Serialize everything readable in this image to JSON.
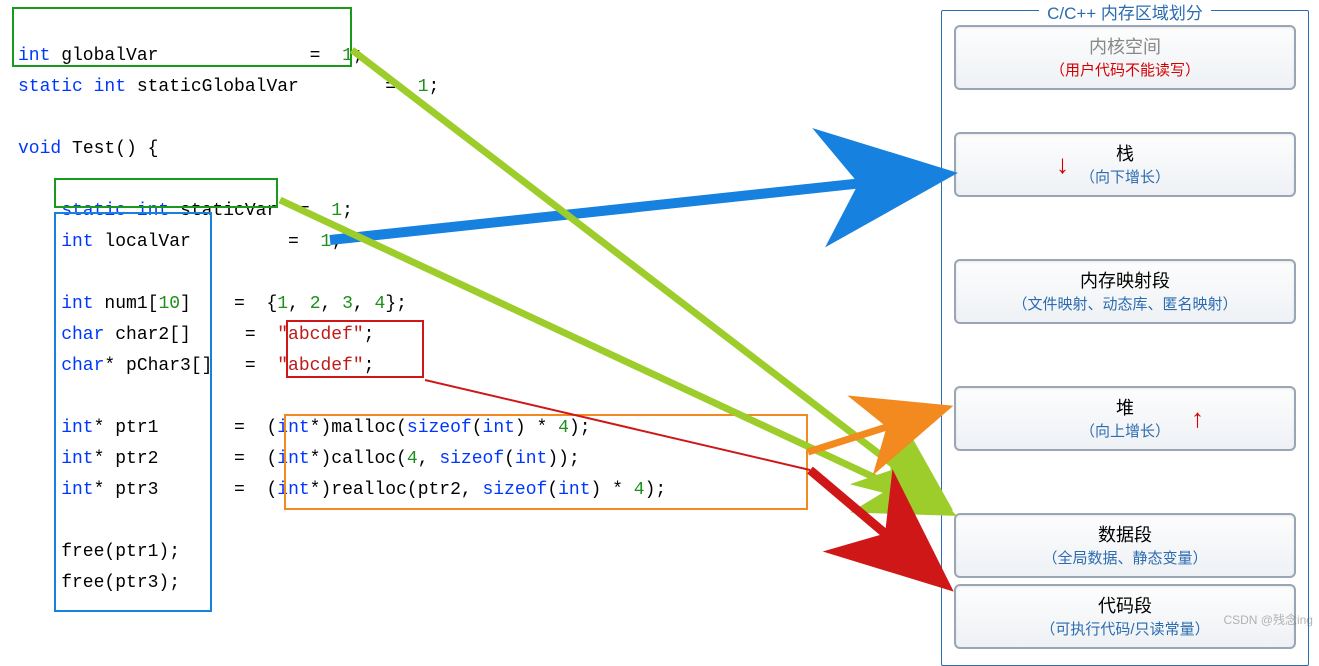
{
  "code": {
    "l1a": "int",
    "l1b": " globalVar              =  ",
    "l1c": "1",
    "l1d": ";",
    "l2a": "static",
    "l2b": " int",
    "l2c": " staticGlobalVar        =  ",
    "l2d": "1",
    "l2e": ";",
    "l4a": "void",
    "l4b": " Test() {",
    "l6a": "    static",
    "l6b": " int",
    "l6c": " staticVar",
    "l6d": "  =  ",
    "l6e": "1",
    "l6f": ";",
    "l7a": "    int",
    "l7b": " localVar         =  ",
    "l7c": "1",
    "l7d": ";",
    "l9a": "    int",
    "l9b": " num1[",
    "l9c": "10",
    "l9d": "]    =  {",
    "l9e": "1",
    "l9f": ", ",
    "l9g": "2",
    "l9h": ", ",
    "l9i": "3",
    "l9j": ", ",
    "l9k": "4",
    "l9l": "};",
    "l10a": "    char",
    "l10b": " char2[]     =  ",
    "l10c": "\"abcdef\"",
    "l10d": ";",
    "l11a": "    char",
    "l11b": "* pChar3[]   =  ",
    "l11c": "\"abcdef\"",
    "l11d": ";",
    "l13a": "    int",
    "l13b": "* ptr1       =  (",
    "l13c": "int",
    "l13d": "*)malloc(",
    "l13e": "sizeof",
    "l13f": "(",
    "l13g": "int",
    "l13h": ") * ",
    "l13i": "4",
    "l13j": ");",
    "l14a": "    int",
    "l14b": "* ptr2       =  (",
    "l14c": "int",
    "l14d": "*)calloc(",
    "l14e": "4",
    "l14f": ", ",
    "l14g": "sizeof",
    "l14h": "(",
    "l14i": "int",
    "l14j": "));",
    "l15a": "    int",
    "l15b": "* ptr3       =  (",
    "l15c": "int",
    "l15d": "*)realloc(ptr2, ",
    "l15e": "sizeof",
    "l15f": "(",
    "l15g": "int",
    "l15h": ") * ",
    "l15i": "4",
    "l15j": ");",
    "l17": "    free(ptr1);",
    "l18": "    free(ptr3);"
  },
  "panel": {
    "title": "C/C++ 内存区域划分",
    "kernel": {
      "title": "内核空间",
      "sub": "（用户代码不能读写）"
    },
    "stack": {
      "title": "栈",
      "sub": "（向下增长）",
      "arrow": "↓"
    },
    "mmap": {
      "title": "内存映射段",
      "sub": "（文件映射、动态库、匿名映射）"
    },
    "heap": {
      "title": "堆",
      "sub": "（向上增长）",
      "arrow": "↑"
    },
    "data": {
      "title": "数据段",
      "sub": "（全局数据、静态变量）"
    },
    "text": {
      "title": "代码段",
      "sub": "（可执行代码/只读常量）"
    }
  },
  "colors": {
    "green": "#1a9a1a",
    "blue": "#1781e0",
    "red": "#d01717",
    "orange": "#f28a1f",
    "lime": "#9ccd2a"
  },
  "watermark": "CSDN @残念ing"
}
